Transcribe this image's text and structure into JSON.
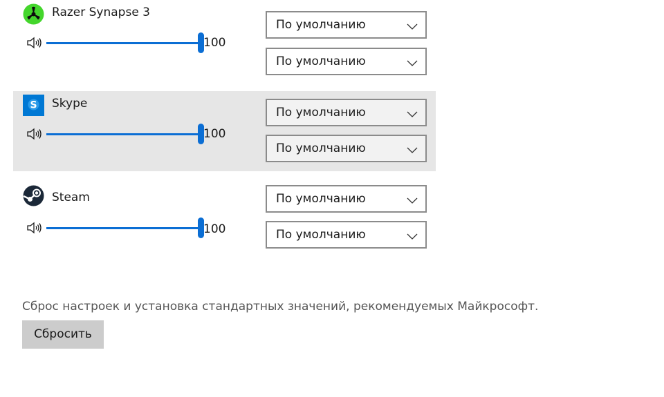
{
  "apps": [
    {
      "name": "Razer Synapse 3",
      "icon": "razer-logo-icon",
      "volume": "100",
      "output_device": "По умолчанию",
      "input_device": "По умолчанию"
    },
    {
      "name": "Skype",
      "icon": "skype-logo-icon",
      "volume": "100",
      "output_device": "По умолчанию",
      "input_device": "По умолчанию"
    },
    {
      "name": "Steam",
      "icon": "steam-logo-icon",
      "volume": "100",
      "output_device": "По умолчанию",
      "input_device": "По умолчанию"
    }
  ],
  "reset": {
    "description": "Сброс настроек и установка стандартных значений, рекомендуемых Майкрософт.",
    "button_label": "Сбросить"
  },
  "colors": {
    "accent": "#0b6ed4",
    "highlight_row": "#e6e6e6",
    "button_bg": "#cccccc"
  }
}
